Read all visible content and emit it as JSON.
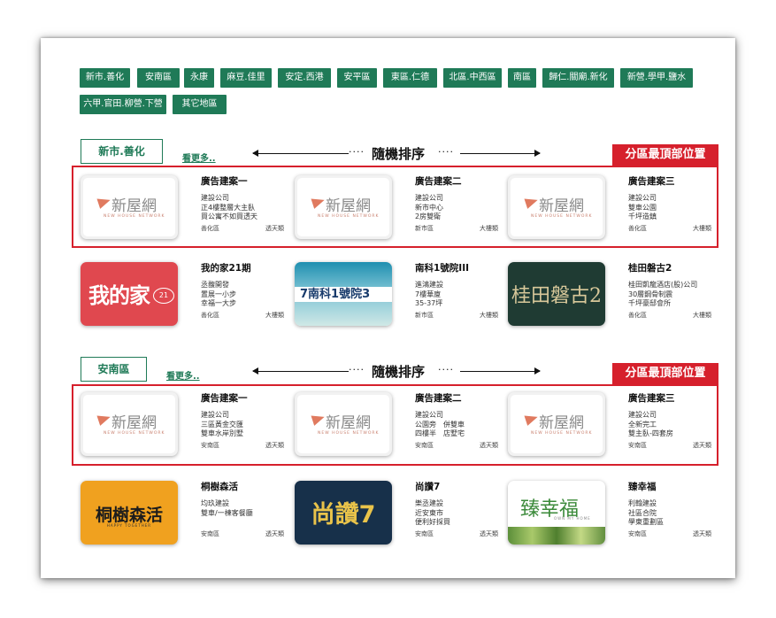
{
  "area_tags": [
    "新市.善化",
    "安南區",
    "永康",
    "麻豆.佳里",
    "安定.西港",
    "安平區",
    "東區.仁德",
    "北區.中西區",
    "南區",
    "歸仁.關廟.新化",
    "新營.學甲.鹽水",
    "六甲.官田.柳營.下營",
    "其它地區"
  ],
  "colors": {
    "brand_green": "#1f7a57",
    "alert_red": "#d6202c"
  },
  "sections": [
    {
      "area": "新市.善化",
      "more": "看更多..",
      "random_text": "隨機排序",
      "top_label": "分區最頂部位置",
      "ad_cards": [
        {
          "title": "廣告建案一",
          "lines": [
            "建設公司",
            "正4樓整層大主臥",
            "買公寓不如買透天"
          ],
          "district": "善化區",
          "type": "透天類",
          "logo": "新屋網",
          "logo_sub": "NEW HOUSE NETWORK"
        },
        {
          "title": "廣告建案二",
          "lines": [
            "建設公司",
            "新市中心",
            "2房雙衛"
          ],
          "district": "新市區",
          "type": "大樓類",
          "logo": "新屋網",
          "logo_sub": "NEW HOUSE NETWORK"
        },
        {
          "title": "廣告建案三",
          "lines": [
            "建設公司",
            "雙車公園",
            "千坪造鎮"
          ],
          "district": "善化區",
          "type": "大樓類",
          "logo": "新屋網",
          "logo_sub": "NEW HOUSE NETWORK"
        }
      ],
      "cards": [
        {
          "title": "我的家21期",
          "lines": [
            "丞馥開發",
            "置展一小步",
            "幸福一大步"
          ],
          "district": "善化區",
          "type": "大樓類",
          "thumb_text": "我的家",
          "thumb_badge": "21"
        },
        {
          "title": "南科1號院III",
          "lines": [
            "進鴻建設",
            "7樓華廈",
            "35-37坪"
          ],
          "district": "新市區",
          "type": "大樓類",
          "thumb_text": "7南科1號院3"
        },
        {
          "title": "桂田磐古2",
          "lines": [
            "桂田凱龍酒店(股)公司",
            "30層鋼骨制震",
            "千坪豪邸會所"
          ],
          "district": "善化區",
          "type": "大樓類",
          "thumb_text": "桂田磐古2"
        }
      ]
    },
    {
      "area": "安南區",
      "more": "看更多..",
      "random_text": "隨機排序",
      "top_label": "分區最頂部位置",
      "ad_cards": [
        {
          "title": "廣告建案一",
          "lines": [
            "建設公司",
            "三區黃金交匯",
            "雙車水岸別墅"
          ],
          "district": "安南區",
          "type": "透天類",
          "logo": "新屋網",
          "logo_sub": "NEW HOUSE NETWORK"
        },
        {
          "title": "廣告建案二",
          "lines": [
            "建設公司",
            "公園旁　併雙車",
            "四樓半　店墅宅"
          ],
          "district": "安南區",
          "type": "透天類",
          "logo": "新屋網",
          "logo_sub": "NEW HOUSE NETWORK"
        },
        {
          "title": "廣告建案三",
          "lines": [
            "建設公司",
            "全新完工",
            "雙主臥-四套房"
          ],
          "district": "安南區",
          "type": "透天類",
          "logo": "新屋網",
          "logo_sub": "NEW HOUSE NETWORK"
        }
      ],
      "cards": [
        {
          "title": "桐樹森活",
          "lines": [
            "均玖建設",
            "雙車/一棟客餐廳"
          ],
          "district": "安南區",
          "type": "透天類",
          "thumb_text": "桐樹森活",
          "thumb_sub": "HAPPY TOGETHER"
        },
        {
          "title": "尚讚7",
          "lines": [
            "樂丞建設",
            "近安東市",
            "便利好採買"
          ],
          "district": "安南區",
          "type": "透天類",
          "thumb_text": "尚讚7"
        },
        {
          "title": "臻幸福",
          "lines": [
            "利翰建設",
            "社區合院",
            "學東重劃區"
          ],
          "district": "安南區",
          "type": "透天類",
          "thumb_text": "臻幸福",
          "thumb_sub": "OWN MY HOME"
        }
      ]
    }
  ]
}
